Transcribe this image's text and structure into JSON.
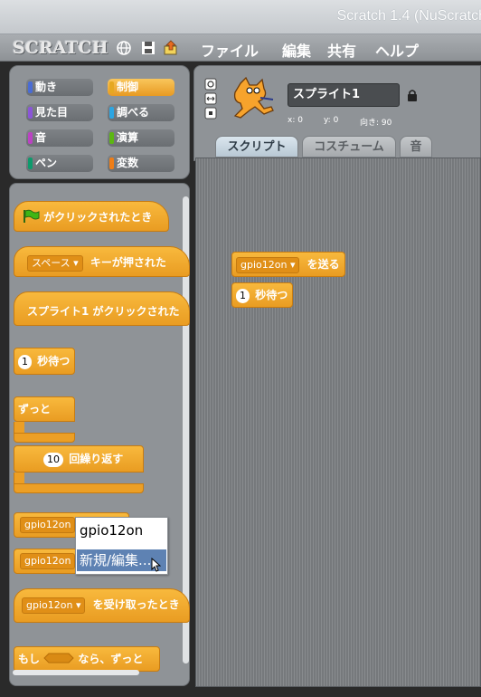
{
  "window": {
    "title": "Scratch 1.4 (NuScratch"
  },
  "menu": {
    "logo": "SCRATCH",
    "items": [
      "ファイル",
      "編集",
      "共有",
      "ヘルプ"
    ],
    "icons": [
      "globe-icon",
      "save-disk-icon",
      "share-upload-icon"
    ]
  },
  "categories": [
    {
      "label": "動き",
      "color": "#4a6cd4",
      "active": false
    },
    {
      "label": "制御",
      "color": "#e6a822",
      "active": true
    },
    {
      "label": "見た目",
      "color": "#8a55d7",
      "active": false
    },
    {
      "label": "調べる",
      "color": "#2ca5e2",
      "active": false
    },
    {
      "label": "音",
      "color": "#bb42c3",
      "active": false
    },
    {
      "label": "演算",
      "color": "#5cb712",
      "active": false
    },
    {
      "label": "ペン",
      "color": "#0e9a6c",
      "active": false
    },
    {
      "label": "変数",
      "color": "#ee7d16",
      "active": false
    }
  ],
  "palette": {
    "green_flag": "がクリックされたとき",
    "key_dropdown": "スペース",
    "key_pressed": "キーが押された",
    "sprite_clicked": "スプライト1 がクリックされた",
    "wait_num": "1",
    "wait_label": "秒待つ",
    "forever": "ずっと",
    "repeat_num": "10",
    "repeat_label": "回繰り返す",
    "broadcast_dd1": "gpio12on",
    "broadcast_dd2": "gpio12on",
    "receive_dd": "gpio12on",
    "receive_label": "を受け取ったとき",
    "if_forever_prefix": "もし",
    "if_forever_suffix": "なら、ずっと"
  },
  "popup": {
    "items": [
      "gpio12on",
      "新規/編集..."
    ]
  },
  "sprite": {
    "name": "スプライト1",
    "x_label": "x: 0",
    "y_label": "y: 0",
    "dir_label": "向き: 90"
  },
  "tabs": [
    "スクリプト",
    "コスチューム",
    "音"
  ],
  "script": {
    "broadcast_dd": "gpio12on",
    "broadcast_label": "を送る",
    "wait_num": "1",
    "wait_label": "秒待つ"
  }
}
